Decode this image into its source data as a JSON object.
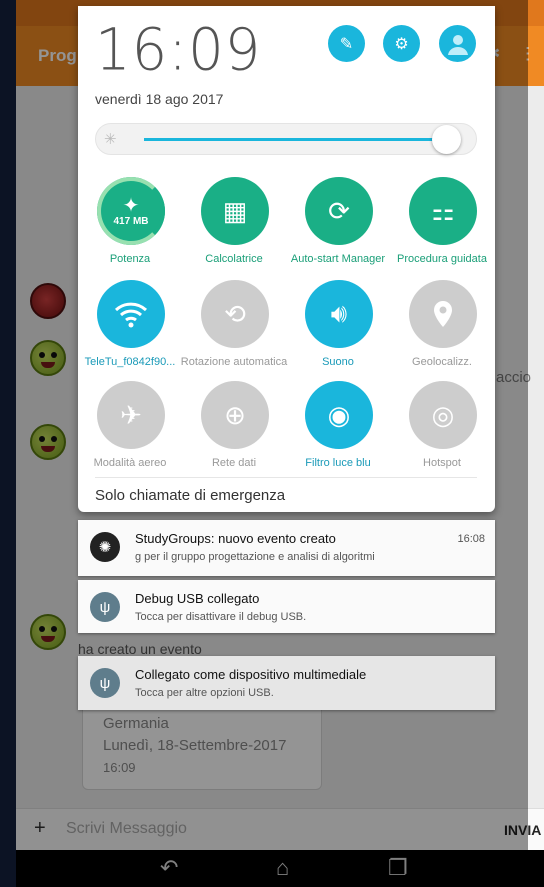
{
  "background_app": {
    "toolbar_title": "Prog",
    "peek_text_right": "accio",
    "peek_text_mid": "ha creato un evento",
    "peek_text_small": "• ...",
    "event_card": {
      "place": "Germania",
      "date": "Lunedì, 18-Settembre-2017",
      "time": "16:09"
    },
    "input": {
      "plus_label": "+",
      "placeholder": "Scrivi Messaggio",
      "send_label": "INVIA"
    }
  },
  "quick_settings": {
    "clock": "16:09",
    "date": "venerdì 18 ago 2017",
    "header_buttons": [
      "edit-icon",
      "gear-icon",
      "profile-icon"
    ],
    "brightness_level": 0.95,
    "memory_badge": "417 MB",
    "tiles": [
      {
        "label": "Potenza",
        "state": "green",
        "icon": "broom-icon"
      },
      {
        "label": "Calcolatrice",
        "state": "green",
        "icon": "calculator-icon"
      },
      {
        "label": "Auto-start Manager",
        "state": "green",
        "icon": "autostart-icon"
      },
      {
        "label": "Procedura guidata",
        "state": "green",
        "icon": "mixer-icon"
      },
      {
        "label": "TeleTu_f0842f90...",
        "state": "on",
        "icon": "wifi-icon"
      },
      {
        "label": "Rotazione automatica",
        "state": "off",
        "icon": "rotation-icon"
      },
      {
        "label": "Suono",
        "state": "on",
        "icon": "sound-icon"
      },
      {
        "label": "Geolocalizz.",
        "state": "off",
        "icon": "location-icon"
      },
      {
        "label": "Modalità aereo",
        "state": "off",
        "icon": "airplane-icon"
      },
      {
        "label": "Rete dati",
        "state": "off",
        "icon": "mobile-data-icon"
      },
      {
        "label": "Filtro luce blu",
        "state": "on",
        "icon": "eye-icon"
      },
      {
        "label": "Hotspot",
        "state": "off",
        "icon": "hotspot-icon"
      }
    ],
    "emergency_text": "Solo chiamate di emergenza"
  },
  "notifications": [
    {
      "title": "StudyGroups: nuovo evento creato",
      "text": "g per il gruppo progettazione e analisi di algoritmi",
      "time": "16:08"
    },
    {
      "title": "Debug USB collegato",
      "text": "Tocca per disattivare il debug USB.",
      "time": ""
    },
    {
      "title": "Collegato come dispositivo multimediale",
      "text": "Tocca per altre opzioni USB.",
      "time": ""
    }
  ],
  "colors": {
    "accent": "#1ab6dc",
    "green": "#1aaf86",
    "toolbar": "#f08a24"
  }
}
